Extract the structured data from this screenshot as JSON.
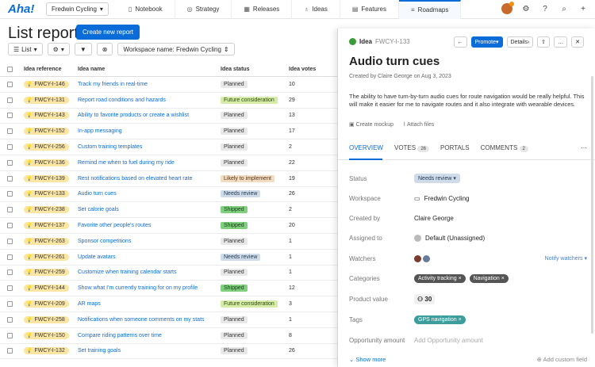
{
  "nav": {
    "logo": "Aha!",
    "workspace": "Fredwin Cycling",
    "tabs": [
      {
        "label": "Notebook",
        "icon": "notebook-icon",
        "glyph": "▯"
      },
      {
        "label": "Strategy",
        "icon": "strategy-icon",
        "glyph": "◎"
      },
      {
        "label": "Releases",
        "icon": "releases-icon",
        "glyph": "▦"
      },
      {
        "label": "Ideas",
        "icon": "ideas-icon",
        "glyph": "♁"
      },
      {
        "label": "Features",
        "icon": "features-icon",
        "glyph": "▤"
      },
      {
        "label": "Roadmaps",
        "icon": "roadmaps-icon",
        "glyph": "≡"
      }
    ]
  },
  "header": {
    "title": "List report",
    "create_button": "Create new report",
    "list_button": "List",
    "workspace_filter": "Workspace name: Fredwin Cycling"
  },
  "table": {
    "columns": [
      "Idea reference",
      "Idea name",
      "Idea status",
      "Idea votes"
    ],
    "rows": [
      {
        "ref": "FWCY-I-146",
        "name": "Track my friends in real-time",
        "status": "Planned",
        "status_class": "st-planned",
        "votes": "10"
      },
      {
        "ref": "FWCY-I-131",
        "name": "Report road conditions and hazards",
        "status": "Future consideration",
        "status_class": "st-future",
        "votes": "29"
      },
      {
        "ref": "FWCY-I-143",
        "name": "Ability to favorite products or create a wishlist",
        "status": "Planned",
        "status_class": "st-planned",
        "votes": "13"
      },
      {
        "ref": "FWCY-I-152",
        "name": "In-app messaging",
        "status": "Planned",
        "status_class": "st-planned",
        "votes": "17"
      },
      {
        "ref": "FWCY-I-256",
        "name": "Custom training templates",
        "status": "Planned",
        "status_class": "st-planned",
        "votes": "2"
      },
      {
        "ref": "FWCY-I-136",
        "name": "Remind me when to fuel during my ride",
        "status": "Planned",
        "status_class": "st-planned",
        "votes": "22"
      },
      {
        "ref": "FWCY-I-139",
        "name": "Rest notifications based on elevated heart rate",
        "status": "Likely to implement",
        "status_class": "st-likely",
        "votes": "19"
      },
      {
        "ref": "FWCY-I-133",
        "name": "Audio turn cues",
        "status": "Needs review",
        "status_class": "st-review",
        "votes": "26"
      },
      {
        "ref": "FWCY-I-238",
        "name": "Set calorie goals",
        "status": "Shipped",
        "status_class": "st-shipped",
        "votes": "2"
      },
      {
        "ref": "FWCY-I-137",
        "name": "Favorite other people's routes",
        "status": "Shipped",
        "status_class": "st-shipped",
        "votes": "20"
      },
      {
        "ref": "FWCY-I-263",
        "name": "Sponsor competitions",
        "status": "Planned",
        "status_class": "st-planned",
        "votes": "1"
      },
      {
        "ref": "FWCY-I-261",
        "name": "Update avatars",
        "status": "Needs review",
        "status_class": "st-review",
        "votes": "1"
      },
      {
        "ref": "FWCY-I-259",
        "name": "Customize when training calendar starts",
        "status": "Planned",
        "status_class": "st-planned",
        "votes": "1"
      },
      {
        "ref": "FWCY-I-144",
        "name": "Show what I'm currently training for on my profile",
        "status": "Shipped",
        "status_class": "st-shipped",
        "votes": "12"
      },
      {
        "ref": "FWCY-I-209",
        "name": "AR maps",
        "status": "Future consideration",
        "status_class": "st-future",
        "votes": "3"
      },
      {
        "ref": "FWCY-I-258",
        "name": "Notifications when someone comments on my stats",
        "status": "Planned",
        "status_class": "st-planned",
        "votes": "1"
      },
      {
        "ref": "FWCY-I-150",
        "name": "Compare riding patterns over time",
        "status": "Planned",
        "status_class": "st-planned",
        "votes": "8"
      },
      {
        "ref": "FWCY-I-132",
        "name": "Set training goals",
        "status": "Planned",
        "status_class": "st-planned",
        "votes": "26"
      }
    ]
  },
  "panel": {
    "type_label": "Idea",
    "ref": "FWCY-I-133",
    "promote": "Promote",
    "details": "Details",
    "title": "Audio turn cues",
    "meta": "Created by Claire George on Aug 3, 2023",
    "description": "The ability to have turn-by-turn audio cues for route navigation would be really helpful. This will make it easier for me to navigate routes and it also integrate with wearable devices.",
    "create_mockup": "Create mockup",
    "attach_files": "Attach files",
    "tabs": {
      "overview": "OVERVIEW",
      "votes": "VOTES",
      "votes_count": "26",
      "portals": "PORTALS",
      "comments": "COMMENTS",
      "comments_count": "2"
    },
    "fields": {
      "status_label": "Status",
      "status_value": "Needs review",
      "workspace_label": "Workspace",
      "workspace_value": "Fredwin Cycling",
      "created_label": "Created by",
      "created_value": "Claire George",
      "assigned_label": "Assigned to",
      "assigned_value": "Default (Unassigned)",
      "watchers_label": "Watchers",
      "notify_watchers": "Notify watchers",
      "categories_label": "Categories",
      "category_1": "Activity tracking",
      "category_2": "Navigation",
      "product_value_label": "Product value",
      "product_value": "30",
      "tags_label": "Tags",
      "tag_1": "GPS navigation",
      "opportunity_label": "Opportunity amount",
      "opportunity_placeholder": "Add Opportunity amount"
    },
    "show_more": "Show more",
    "add_custom_field": "Add custom field"
  }
}
